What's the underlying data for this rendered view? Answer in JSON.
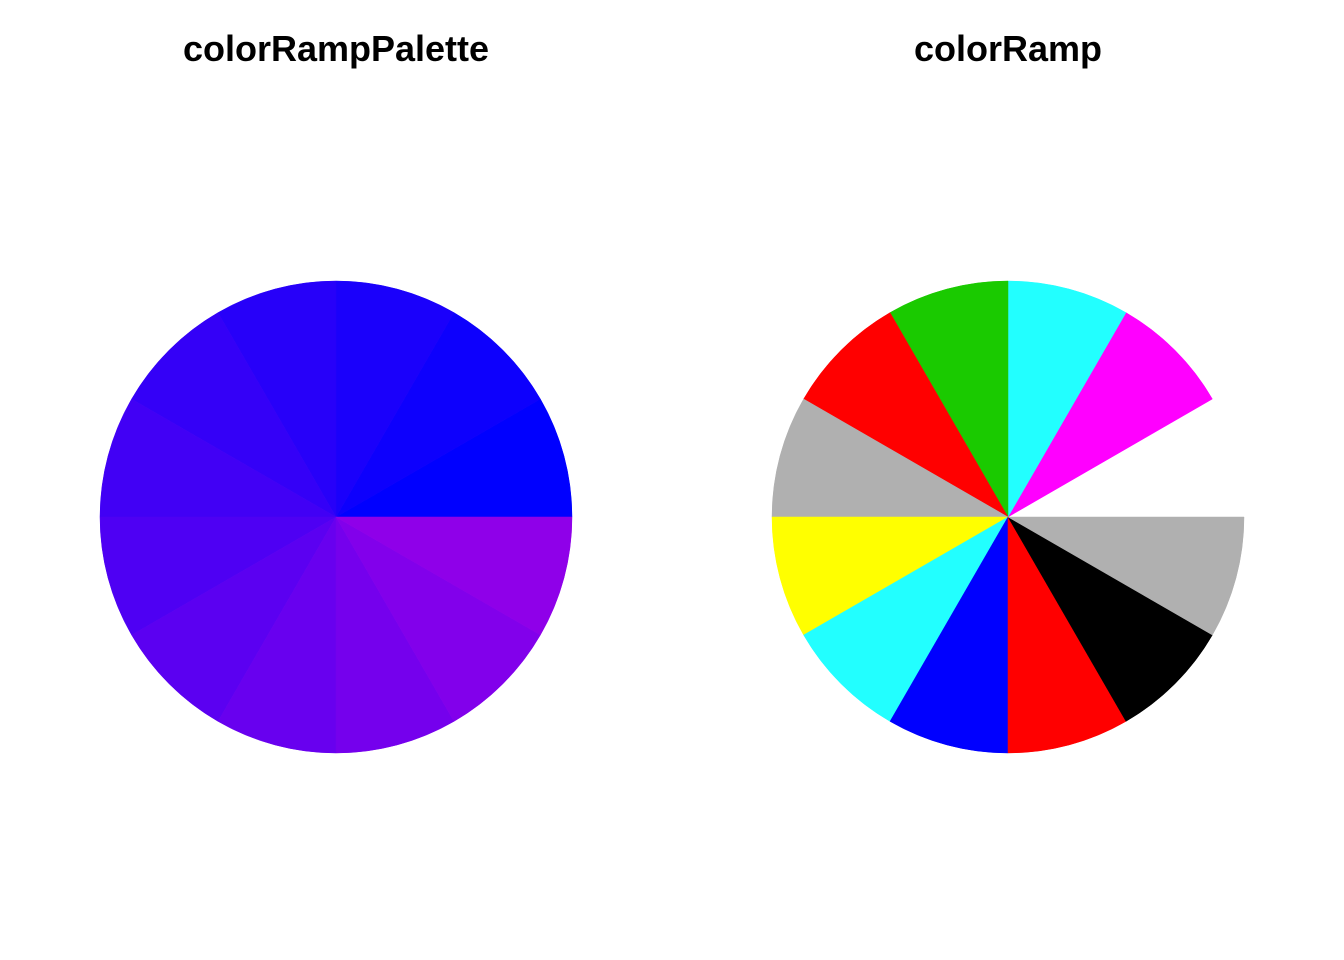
{
  "chart_data": [
    {
      "type": "pie",
      "title": "colorRampPalette",
      "values": [
        1,
        1,
        1,
        1,
        1,
        1,
        1,
        1,
        1,
        1,
        1,
        1
      ],
      "start_angle_deg": 0,
      "direction": "counterclockwise",
      "colors": [
        "#0000FF",
        "#0D00FD",
        "#1A00FB",
        "#2700F9",
        "#3400F7",
        "#4100F5",
        "#4E00F3",
        "#5B00F1",
        "#6800EF",
        "#7500ED",
        "#8200EB",
        "#8F00E9"
      ]
    },
    {
      "type": "pie",
      "title": "colorRamp",
      "values": [
        1,
        1,
        1,
        1,
        1,
        1,
        1,
        1,
        1,
        1,
        1,
        1
      ],
      "start_angle_deg": 0,
      "direction": "counterclockwise",
      "colors": [
        "#FFFFFF",
        "#FF00FF",
        "#22FFFF",
        "#1ACA00",
        "#FF0000",
        "#B0B0B0",
        "#FFFF00",
        "#22FFFF",
        "#0000FF",
        "#FF0000",
        "#000000",
        "#B0B0B0"
      ]
    }
  ]
}
